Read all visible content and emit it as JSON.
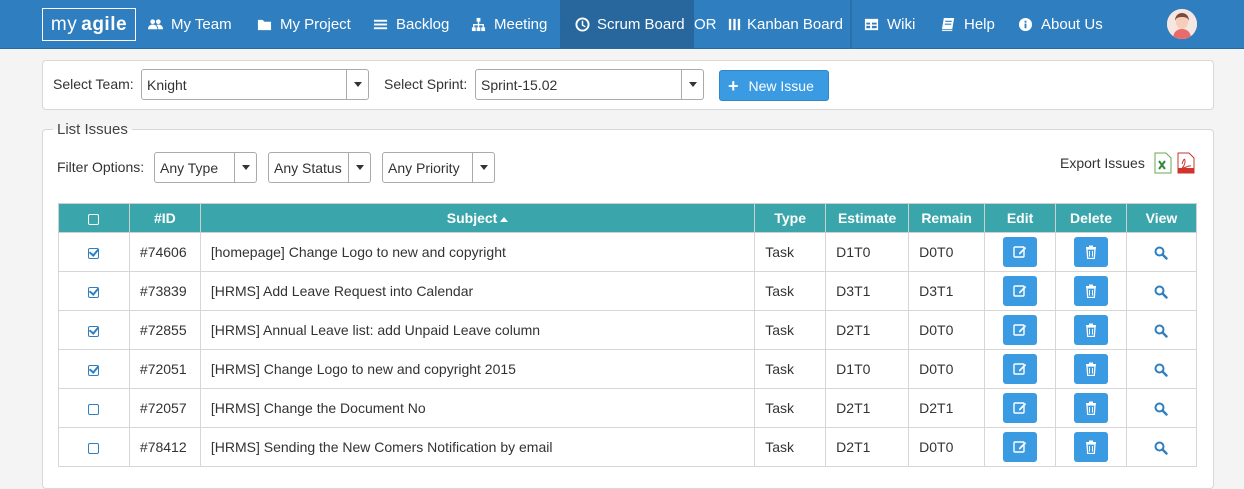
{
  "nav": {
    "logo_text": "my",
    "logo_bold": "agile",
    "items": [
      {
        "label": "My Team",
        "icon": "users-icon"
      },
      {
        "label": "My Project",
        "icon": "folder-icon"
      },
      {
        "label": "Backlog",
        "icon": "list-icon"
      },
      {
        "label": "Meeting",
        "icon": "sitemap-icon"
      },
      {
        "label": "Scrum Board",
        "icon": "clock-icon",
        "active": true
      },
      {
        "label": "OR"
      },
      {
        "label": "Kanban Board",
        "icon": "columns-icon"
      },
      {
        "label": "Wiki",
        "icon": "table-icon"
      },
      {
        "label": "Help",
        "icon": "book-icon"
      },
      {
        "label": "About Us",
        "icon": "info-icon"
      }
    ],
    "accent": "#2f7fc0"
  },
  "top": {
    "team_label": "Select Team:",
    "team_value": "Knight",
    "sprint_label": "Select Sprint:",
    "sprint_value": "Sprint-15.02",
    "new_issue_label": "New Issue"
  },
  "list": {
    "title": "List Issues",
    "filter_label": "Filter Options:",
    "filters": [
      "Any Type",
      "Any Status",
      "Any Priority"
    ],
    "export_label": "Export Issues",
    "columns": [
      "#ID",
      "Subject",
      "Type",
      "Estimate",
      "Remain",
      "Edit",
      "Delete",
      "View"
    ],
    "rows": [
      {
        "checked": true,
        "id": "#74606",
        "subject": "[homepage] Change Logo to new and copyright",
        "type": "Task",
        "estimate": "D1T0",
        "remain": "D0T0"
      },
      {
        "checked": true,
        "id": "#73839",
        "subject": "[HRMS] Add Leave Request into Calendar",
        "type": "Task",
        "estimate": "D3T1",
        "remain": "D3T1"
      },
      {
        "checked": true,
        "id": "#72855",
        "subject": "[HRMS] Annual Leave list: add Unpaid Leave column",
        "type": "Task",
        "estimate": "D2T1",
        "remain": "D0T0"
      },
      {
        "checked": true,
        "id": "#72051",
        "subject": "[HRMS] Change Logo to new and copyright 2015",
        "type": "Task",
        "estimate": "D1T0",
        "remain": "D0T0"
      },
      {
        "checked": false,
        "id": "#72057",
        "subject": "[HRMS] Change the Document No",
        "type": "Task",
        "estimate": "D2T1",
        "remain": "D2T1"
      },
      {
        "checked": false,
        "id": "#78412",
        "subject": "[HRMS] Sending the New Comers Notification by email",
        "type": "Task",
        "estimate": "D2T1",
        "remain": "D0T0"
      }
    ],
    "header_color": "#3aa6ac",
    "button_color": "#3a9be2"
  }
}
